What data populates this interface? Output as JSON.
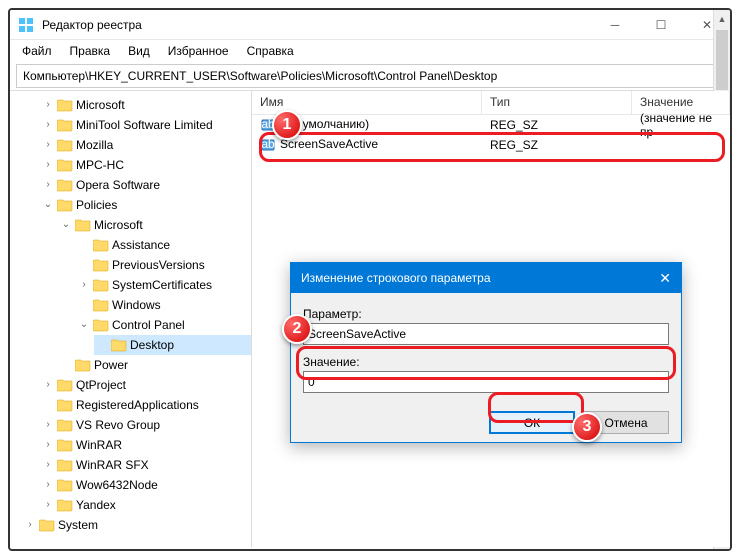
{
  "window": {
    "title": "Редактор реестра"
  },
  "menu": [
    "Файл",
    "Правка",
    "Вид",
    "Избранное",
    "Справка"
  ],
  "address": "Компьютер\\HKEY_CURRENT_USER\\Software\\Policies\\Microsoft\\Control Panel\\Desktop",
  "tree": [
    {
      "lvl": 0,
      "caret": ">",
      "label": "Microsoft"
    },
    {
      "lvl": 0,
      "caret": ">",
      "label": "MiniTool Software Limited"
    },
    {
      "lvl": 0,
      "caret": ">",
      "label": "Mozilla"
    },
    {
      "lvl": 0,
      "caret": ">",
      "label": "MPC-HC"
    },
    {
      "lvl": 0,
      "caret": ">",
      "label": "Opera Software"
    },
    {
      "lvl": 0,
      "caret": "v",
      "label": "Policies"
    },
    {
      "lvl": 1,
      "caret": "v",
      "label": "Microsoft"
    },
    {
      "lvl": 2,
      "caret": "",
      "label": "Assistance"
    },
    {
      "lvl": 2,
      "caret": "",
      "label": "PreviousVersions"
    },
    {
      "lvl": 2,
      "caret": ">",
      "label": "SystemCertificates"
    },
    {
      "lvl": 2,
      "caret": "",
      "label": "Windows"
    },
    {
      "lvl": 2,
      "caret": "v",
      "label": "Control Panel"
    },
    {
      "lvl": 3,
      "caret": "",
      "label": "Desktop",
      "sel": true
    },
    {
      "lvl": 1,
      "caret": "",
      "label": "Power"
    },
    {
      "lvl": 0,
      "caret": ">",
      "label": "QtProject"
    },
    {
      "lvl": 0,
      "caret": "",
      "label": "RegisteredApplications"
    },
    {
      "lvl": 0,
      "caret": ">",
      "label": "VS Revo Group"
    },
    {
      "lvl": 0,
      "caret": ">",
      "label": "WinRAR"
    },
    {
      "lvl": 0,
      "caret": ">",
      "label": "WinRAR SFX"
    },
    {
      "lvl": 0,
      "caret": ">",
      "label": "Wow6432Node"
    },
    {
      "lvl": 0,
      "caret": ">",
      "label": "Yandex"
    },
    {
      "lvl": -1,
      "caret": ">",
      "label": "System"
    }
  ],
  "columns": {
    "name": "Имя",
    "type": "Тип",
    "value": "Значение"
  },
  "rows": [
    {
      "name": "(По умолчанию)",
      "type": "REG_SZ",
      "value": "(значение не пр"
    },
    {
      "name": "ScreenSaveActive",
      "type": "REG_SZ",
      "value": ""
    }
  ],
  "dialog": {
    "title": "Изменение строкового параметра",
    "param_label": "Параметр:",
    "param_value": "ScreenSaveActive",
    "value_label": "Значение:",
    "value_value": "0",
    "ok": "ОК",
    "cancel": "Отмена"
  },
  "badges": {
    "1": "1",
    "2": "2",
    "3": "3"
  }
}
